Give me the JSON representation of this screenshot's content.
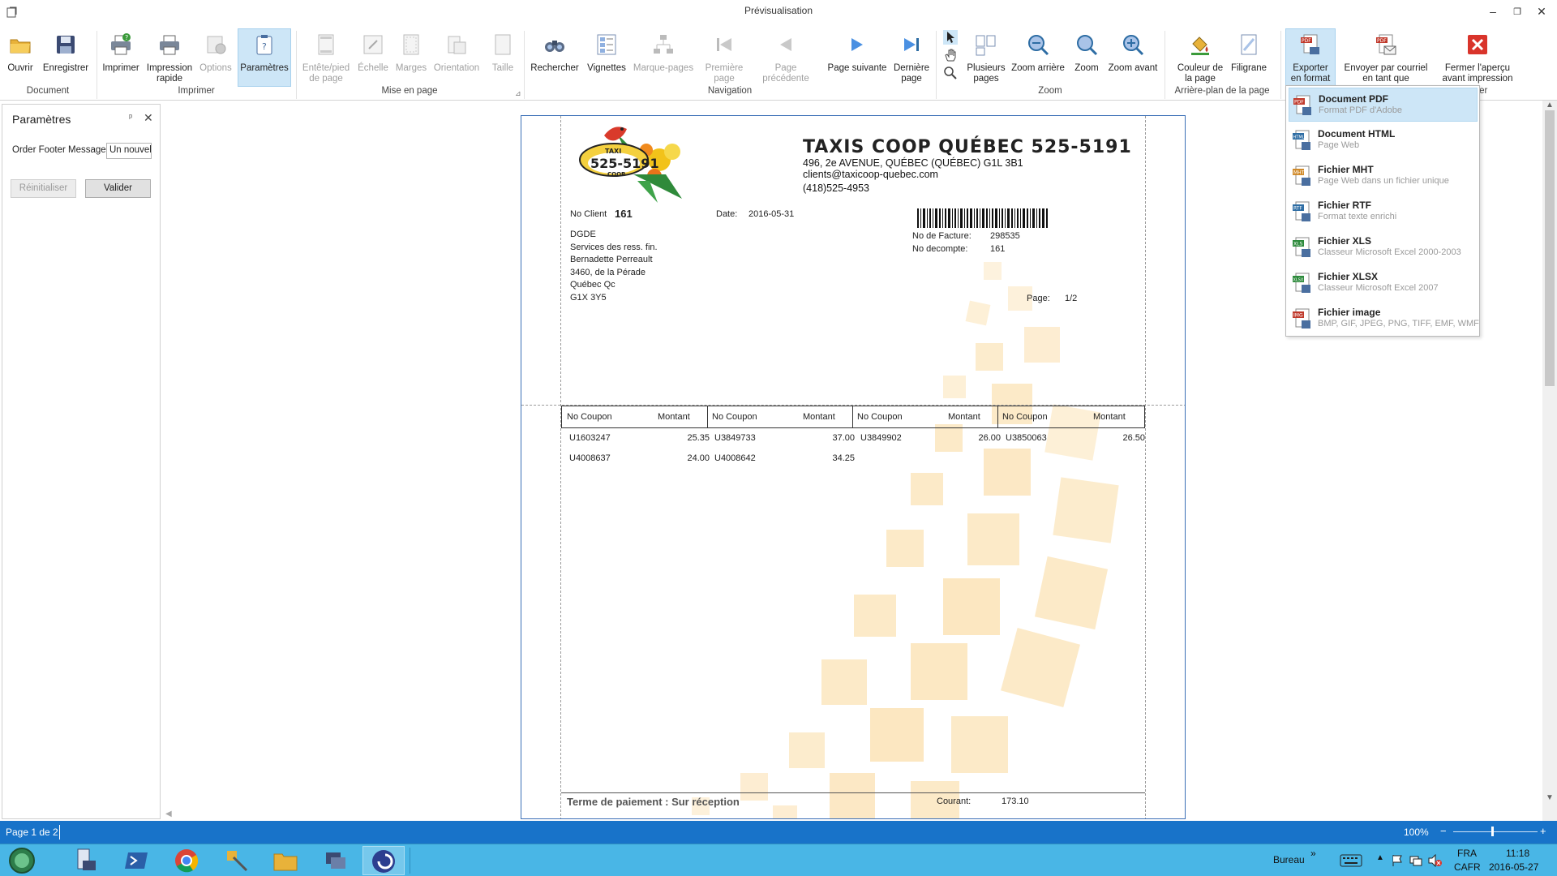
{
  "window": {
    "title": "Prévisualisation",
    "minimize": "–",
    "restore": "❐",
    "close": "✕"
  },
  "ribbon": {
    "groups": {
      "document": "Document",
      "imprimer": "Imprimer",
      "mise_en_page": "Mise en page",
      "navigation": "Navigation",
      "zoom": "Zoom",
      "arriere_plan": "Arrière-plan de la page",
      "fermer_partial": "her"
    },
    "buttons": {
      "ouvrir": "Ouvrir",
      "enregistrer": "Enregistrer",
      "imprimer": "Imprimer",
      "impression_rapide": "Impression\nrapide",
      "options": "Options",
      "parametres": "Paramètres",
      "entete_pied": "Entête/pied\nde page",
      "echelle": "Échelle",
      "marges": "Marges",
      "orientation": "Orientation",
      "taille": "Taille",
      "rechercher": "Rechercher",
      "vignettes": "Vignettes",
      "marque_pages": "Marque-pages",
      "premiere_page": "Première\npage",
      "page_precedente": "Page précédente",
      "page_suivante": "Page suivante",
      "derniere_page": "Dernière\npage",
      "plusieurs_pages": "Plusieurs\npages",
      "zoom_arriere": "Zoom arrière",
      "zoom": "Zoom",
      "zoom_avant": "Zoom avant",
      "couleur_page": "Couleur de\nla page",
      "filigrane": "Filigrane",
      "exporter": "Exporter\nen format",
      "envoyer": "Envoyer par courriel\nen tant que",
      "fermer": "Fermer l'aperçu\navant impression"
    }
  },
  "export_menu": {
    "items": [
      {
        "title": "Document PDF",
        "subtitle": "Format PDF d'Adobe",
        "icon": "pdf-file-icon",
        "color": "#c0392b",
        "tag": "PDF"
      },
      {
        "title": "Document HTML",
        "subtitle": "Page Web",
        "icon": "html-file-icon",
        "color": "#2e6da4",
        "tag": "HTML"
      },
      {
        "title": "Fichier MHT",
        "subtitle": "Page Web dans un fichier unique",
        "icon": "mht-file-icon",
        "color": "#d08a2a",
        "tag": "MHT"
      },
      {
        "title": "Fichier RTF",
        "subtitle": "Format texte enrichi",
        "icon": "rtf-file-icon",
        "color": "#2e6da4",
        "tag": "RTF"
      },
      {
        "title": "Fichier XLS",
        "subtitle": "Classeur Microsoft Excel 2000-2003",
        "icon": "xls-file-icon",
        "color": "#2e8b3d",
        "tag": "XLS"
      },
      {
        "title": "Fichier XLSX",
        "subtitle": "Classeur Microsoft Excel 2007",
        "icon": "xlsx-file-icon",
        "color": "#2e8b3d",
        "tag": "XLSX"
      },
      {
        "title": "Fichier image",
        "subtitle": "BMP, GIF, JPEG, PNG, TIFF, EMF, WMF",
        "icon": "image-file-icon",
        "color": "#c0392b",
        "tag": "IMG"
      }
    ]
  },
  "panel": {
    "title": "Paramètres",
    "pin": "ᵖ",
    "close": "✕",
    "field_label": "Order Footer Message",
    "field_value": "Un nouvel",
    "reset_label": "Réinitialiser",
    "validate_label": "Valider"
  },
  "invoice": {
    "logo_number": "525-5191",
    "logo_taxi": "TAXI",
    "logo_coop": "COOP",
    "company": "TAXIS COOP QUÉBEC 525-5191",
    "address": "496, 2e AVENUE, QUÉBEC (QUÉBEC) G1L 3B1",
    "email": "clients@taxicoop-quebec.com",
    "phone": "(418)525-4953",
    "client_label": "No Client",
    "client_value": "161",
    "date_label": "Date:",
    "date_value": "2016-05-31",
    "customer_lines": [
      "DGDE",
      "Services des ress. fin.",
      "Bernadette Perreault",
      "3460, de la Pérade",
      "Québec Qc",
      "G1X 3Y5"
    ],
    "facture_label": "No de Facture:",
    "facture_value": "298535",
    "decompte_label": "No decompte:",
    "decompte_value": "161",
    "page_label": "Page:",
    "page_value": "1/2",
    "col_coupon": "No Coupon",
    "col_montant": "Montant",
    "coupons": [
      {
        "coupon": "U1603247",
        "montant": "25.35"
      },
      {
        "coupon": "U3849733",
        "montant": "37.00"
      },
      {
        "coupon": "U3849902",
        "montant": "26.00"
      },
      {
        "coupon": "U3850063",
        "montant": "26.50"
      },
      {
        "coupon": "U4008637",
        "montant": "24.00"
      },
      {
        "coupon": "U4008642",
        "montant": "34.25"
      }
    ],
    "terms": "Terme de paiement : Sur réception",
    "courant_label": "Courant:",
    "courant_value": "173.10"
  },
  "statusbar": {
    "page": "Page 1 de 2",
    "zoom": "100%",
    "minus": "−",
    "plus": "+"
  },
  "taskbar": {
    "bureau": "Bureau",
    "chevron": "»",
    "lang": "FRA",
    "layout": "CAFR",
    "time": "11:18",
    "date": "2016-05-27"
  }
}
